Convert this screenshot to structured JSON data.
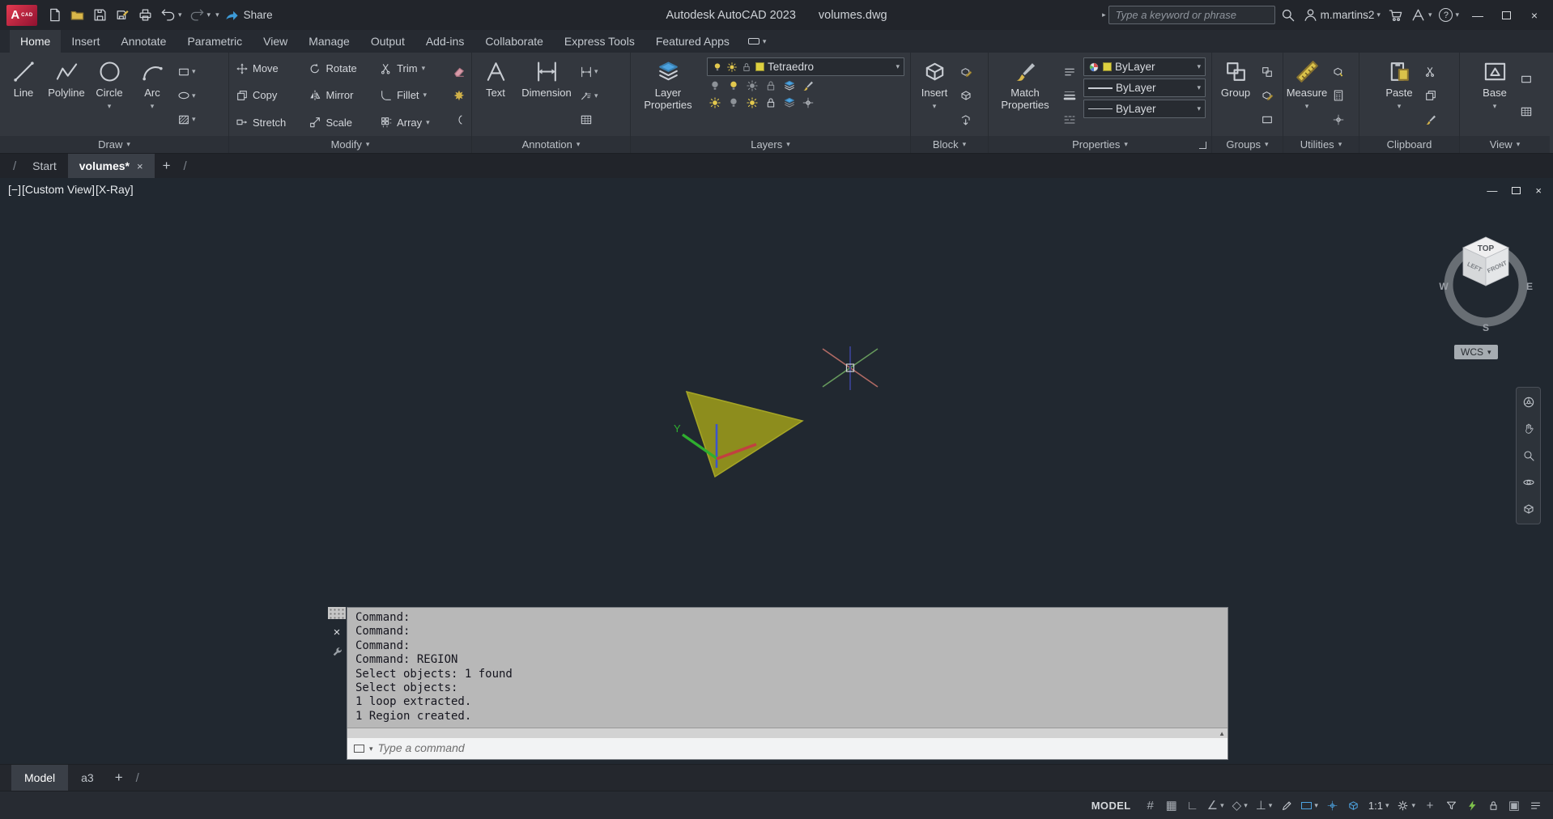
{
  "colors": {
    "accent_blue": "#4da3e0",
    "autocad_red": "#c01f3c",
    "layer_yellow": "#ddd040",
    "region_olive": "#8d8d1d",
    "command_bg": "#b8b8b8"
  },
  "icons": {
    "caret": "▾",
    "caret_right": "▸",
    "slash": "/",
    "plus": "+",
    "close": "×",
    "minimize": "—",
    "scroll_up": "▲",
    "grid": "#",
    "snap": "▦",
    "ortho": "∟",
    "polar": "∠",
    "iso": "◇",
    "osnap": "⊥",
    "frame": "▣",
    "question": "?"
  },
  "titlebar": {
    "logo_text": "A",
    "logo_badge": "CAD",
    "share_label": "Share",
    "app_title": "Autodesk AutoCAD 2023",
    "doc_name": "volumes.dwg",
    "search_placeholder": "Type a keyword or phrase",
    "username": "m.martins2"
  },
  "ribbon": {
    "tabs": [
      "Home",
      "Insert",
      "Annotate",
      "Parametric",
      "View",
      "Manage",
      "Output",
      "Add-ins",
      "Collaborate",
      "Express Tools",
      "Featured Apps"
    ],
    "panels": {
      "draw": {
        "title": "Draw",
        "line": "Line",
        "polyline": "Polyline",
        "circle": "Circle",
        "arc": "Arc"
      },
      "modify": {
        "title": "Modify",
        "move": "Move",
        "copy": "Copy",
        "stretch": "Stretch",
        "rotate": "Rotate",
        "mirror": "Mirror",
        "scale": "Scale",
        "trim": "Trim",
        "fillet": "Fillet",
        "array": "Array"
      },
      "annotation": {
        "title": "Annotation",
        "text": "Text",
        "dimension": "Dimension"
      },
      "layers": {
        "title": "Layers",
        "layer_properties": "Layer Properties",
        "current_layer": "Tetraedro"
      },
      "block": {
        "title": "Block",
        "insert": "Insert"
      },
      "properties": {
        "title": "Properties",
        "match": "Match Properties",
        "color": "ByLayer",
        "lineweight": "ByLayer",
        "linetype": "ByLayer"
      },
      "groups": {
        "title": "Groups",
        "group": "Group"
      },
      "utilities": {
        "title": "Utilities",
        "measure": "Measure"
      },
      "clipboard": {
        "title": "Clipboard",
        "paste": "Paste"
      },
      "view": {
        "title": "View",
        "base": "Base"
      }
    }
  },
  "file_tabs": {
    "start": "Start",
    "doc": "volumes*"
  },
  "viewport": {
    "minus": "[−]",
    "view_name": "[Custom View]",
    "visual_style": "[X-Ray]",
    "wcs": "WCS",
    "ucs_y": "Y",
    "cube": {
      "top": "TOP",
      "front": "FRONT",
      "left": "LEFT",
      "w": "W",
      "s": "S",
      "e": "E"
    }
  },
  "command": {
    "lines": [
      "Command:",
      "Command:",
      "Command:",
      "Command: REGION",
      "Select objects: 1 found",
      "Select objects:",
      "1 loop extracted.",
      "1 Region created."
    ],
    "placeholder": "Type a command"
  },
  "layout_tabs": {
    "model": "Model",
    "a3": "a3"
  },
  "status": {
    "model": "MODEL",
    "scale": "1:1"
  }
}
